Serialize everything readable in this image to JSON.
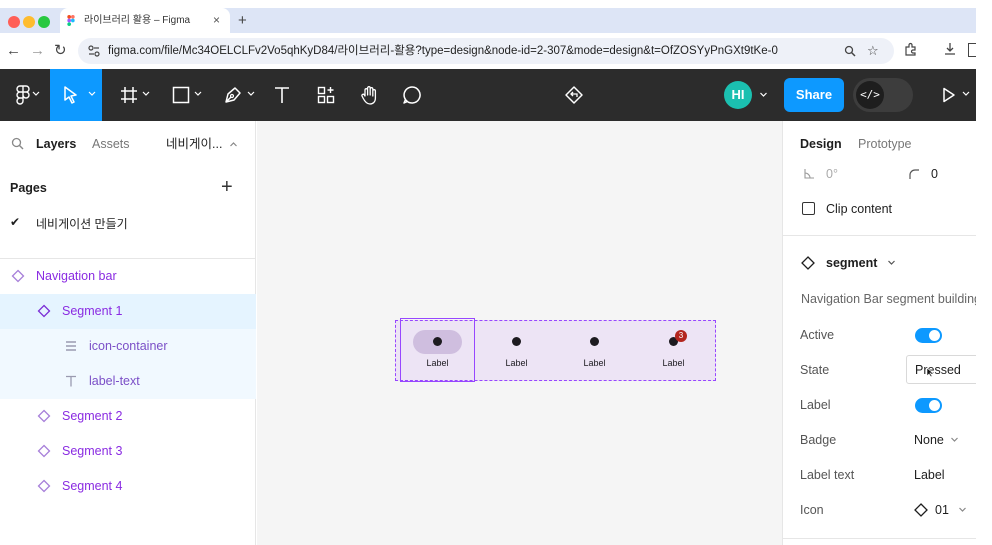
{
  "browser": {
    "tab_title": "라이브러리 활용 – Figma",
    "tab_close": "×",
    "new_tab": "+",
    "url": "figma.com/file/Mc34OELCLFv2Vo5qhKyD84/라이브러리-활용?type=design&node-id=2-307&mode=design&t=OfZOSYyPnGXt9tKe-0"
  },
  "toolbar": {
    "avatar_initials": "HI",
    "share_label": "Share",
    "dev_mode_glyph": "</>"
  },
  "left_panel": {
    "tabs": {
      "layers": "Layers",
      "assets": "Assets",
      "page_switcher": "네비게이..."
    },
    "pages_title": "Pages",
    "pages_add": "+",
    "current_page": "네비게이션 만들기",
    "layers": [
      {
        "name": "Navigation bar",
        "type": "component-set",
        "indent": 0
      },
      {
        "name": "Segment 1",
        "type": "component",
        "indent": 1,
        "selected": true
      },
      {
        "name": "icon-container",
        "type": "frame",
        "indent": 2,
        "child": true
      },
      {
        "name": "label-text",
        "type": "text",
        "indent": 2,
        "child": true
      },
      {
        "name": "Segment 2",
        "type": "component",
        "indent": 1
      },
      {
        "name": "Segment 3",
        "type": "component",
        "indent": 1
      },
      {
        "name": "Segment 4",
        "type": "component",
        "indent": 1
      }
    ]
  },
  "canvas": {
    "segments": [
      {
        "label": "Label",
        "active": true,
        "badge": ""
      },
      {
        "label": "Label",
        "active": false,
        "badge": ""
      },
      {
        "label": "Label",
        "active": false,
        "badge": ""
      },
      {
        "label": "Label",
        "active": false,
        "badge": "3"
      }
    ]
  },
  "right_panel": {
    "tabs": {
      "design": "Design",
      "prototype": "Prototype"
    },
    "rotation": "0°",
    "corner_radius": "0",
    "clip_content": "Clip content",
    "component_name": "segment",
    "component_desc": "Navigation Bar segment building",
    "props": {
      "active_label": "Active",
      "state_label": "State",
      "state_value": "Pressed",
      "label_label": "Label",
      "badge_label": "Badge",
      "badge_value": "None",
      "label_text_label": "Label text",
      "label_text_value": "Label",
      "icon_label": "Icon",
      "icon_value": "01"
    }
  },
  "colors": {
    "figma_blue": "#0d99ff",
    "component_purple": "#9747ff",
    "toolbar_bg": "#2c2c2c",
    "selected_row": "#e5f4ff",
    "badge_red": "#b3261e"
  }
}
